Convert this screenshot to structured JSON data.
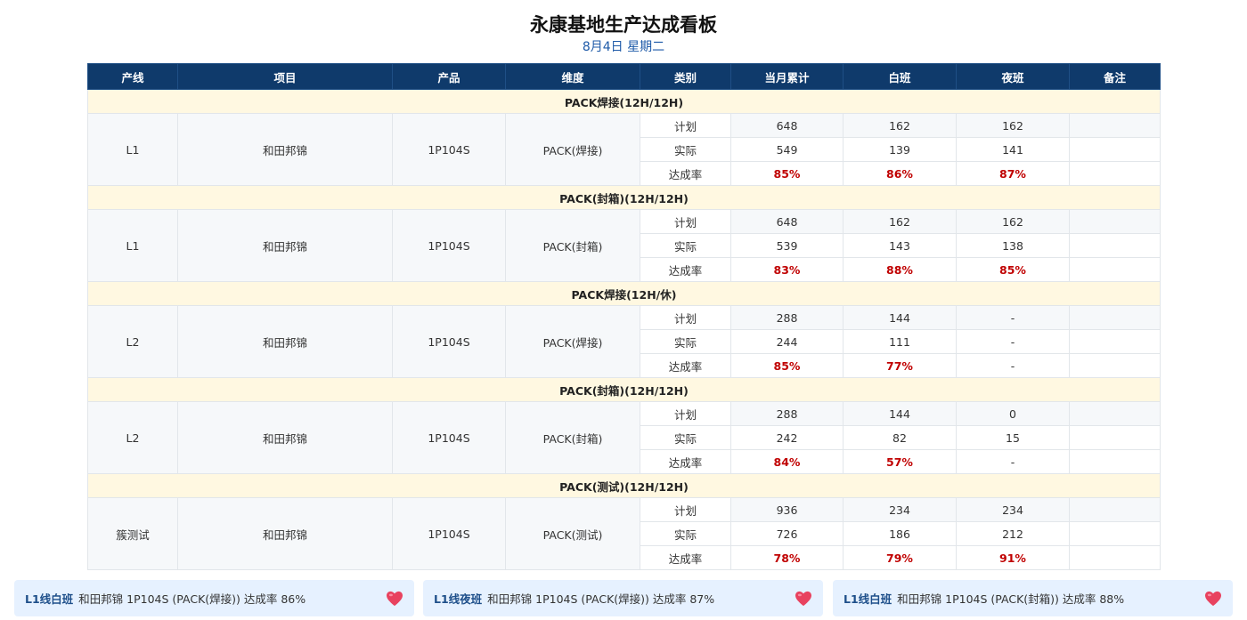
{
  "header": {
    "title": "永康基地生产达成看板",
    "date": "8月4日 星期二"
  },
  "table": {
    "columns": [
      "产线",
      "项目",
      "产品",
      "维度",
      "类别",
      "当月累计",
      "白班",
      "夜班",
      "备注"
    ],
    "groups": [
      {
        "name": "PACK焊接(12H/12H)",
        "line": "L1",
        "project": "和田邦锦",
        "product": "1P104S",
        "dimension": "PACK(焊接)",
        "rows": [
          {
            "category": "计划",
            "monthly": "648",
            "day": "162",
            "night": "162",
            "remark": ""
          },
          {
            "category": "实际",
            "monthly": "549",
            "day": "139",
            "night": "141",
            "remark": ""
          },
          {
            "category": "达成率",
            "monthly": "85%",
            "day": "86%",
            "night": "87%",
            "remark": ""
          }
        ]
      },
      {
        "name": "PACK(封箱)(12H/12H)",
        "line": "L1",
        "project": "和田邦锦",
        "product": "1P104S",
        "dimension": "PACK(封箱)",
        "rows": [
          {
            "category": "计划",
            "monthly": "648",
            "day": "162",
            "night": "162",
            "remark": ""
          },
          {
            "category": "实际",
            "monthly": "539",
            "day": "143",
            "night": "138",
            "remark": ""
          },
          {
            "category": "达成率",
            "monthly": "83%",
            "day": "88%",
            "night": "85%",
            "remark": ""
          }
        ]
      },
      {
        "name": "PACK焊接(12H/休)",
        "line": "L2",
        "project": "和田邦锦",
        "product": "1P104S",
        "dimension": "PACK(焊接)",
        "rows": [
          {
            "category": "计划",
            "monthly": "288",
            "day": "144",
            "night": "-",
            "remark": ""
          },
          {
            "category": "实际",
            "monthly": "244",
            "day": "111",
            "night": "-",
            "remark": ""
          },
          {
            "category": "达成率",
            "monthly": "85%",
            "day": "77%",
            "night": "-",
            "remark": ""
          }
        ]
      },
      {
        "name": "PACK(封箱)(12H/12H)",
        "line": "L2",
        "project": "和田邦锦",
        "product": "1P104S",
        "dimension": "PACK(封箱)",
        "rows": [
          {
            "category": "计划",
            "monthly": "288",
            "day": "144",
            "night": "0",
            "remark": ""
          },
          {
            "category": "实际",
            "monthly": "242",
            "day": "82",
            "night": "15",
            "remark": ""
          },
          {
            "category": "达成率",
            "monthly": "84%",
            "day": "57%",
            "night": "-",
            "remark": ""
          }
        ]
      },
      {
        "name": "PACK(测试)(12H/12H)",
        "line": "簇测试",
        "project": "和田邦锦",
        "product": "1P104S",
        "dimension": "PACK(测试)",
        "rows": [
          {
            "category": "计划",
            "monthly": "936",
            "day": "234",
            "night": "234",
            "remark": ""
          },
          {
            "category": "实际",
            "monthly": "726",
            "day": "186",
            "night": "212",
            "remark": ""
          },
          {
            "category": "达成率",
            "monthly": "78%",
            "day": "79%",
            "night": "91%",
            "remark": ""
          }
        ]
      }
    ]
  },
  "ticker": [
    {
      "line": "L1线白班",
      "text": "和田邦锦 1P104S (PACK(焊接)) 达成率 86%",
      "icon": "heart-icon"
    },
    {
      "line": "L1线夜班",
      "text": "和田邦锦 1P104S (PACK(焊接)) 达成率 87%",
      "icon": "heart-icon"
    },
    {
      "line": "L1线白班",
      "text": "和田邦锦 1P104S (PACK(封箱)) 达成率 88%",
      "icon": "heart-icon"
    }
  ],
  "colors": {
    "header_bg": "#0f3a6b",
    "group_bg": "#fff8e1",
    "rate": "#c00000",
    "ticker_bg": "#e6f1ff",
    "heart": "#e8425f"
  }
}
